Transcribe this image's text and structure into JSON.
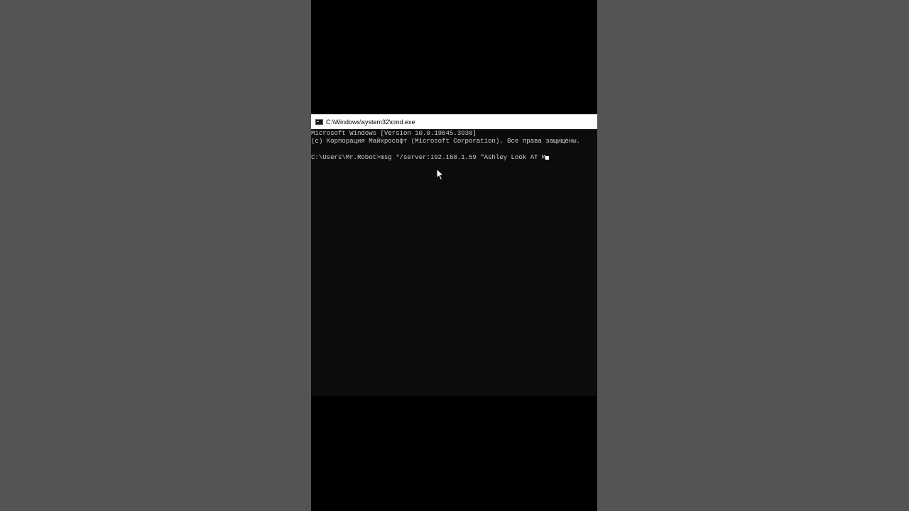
{
  "window": {
    "title": "C:\\Windows\\system32\\cmd.exe",
    "icon": "cmd-icon"
  },
  "console": {
    "lines": [
      "Microsoft Windows [Version 10.0.19045.3930]",
      "(c) Корпорация Майкрософт (Microsoft Corporation). Все права защищены.",
      "",
      "C:\\Users\\Mr.Robot>msg */server:192.168.1.59 \"Ashley Look AT M"
    ]
  },
  "colors": {
    "page_background": "#545454",
    "frame_background": "#000000",
    "console_background": "#0c0c0c",
    "console_text": "#cccccc",
    "titlebar_background": "#ffffff"
  },
  "pointer": "mouse-cursor-icon"
}
